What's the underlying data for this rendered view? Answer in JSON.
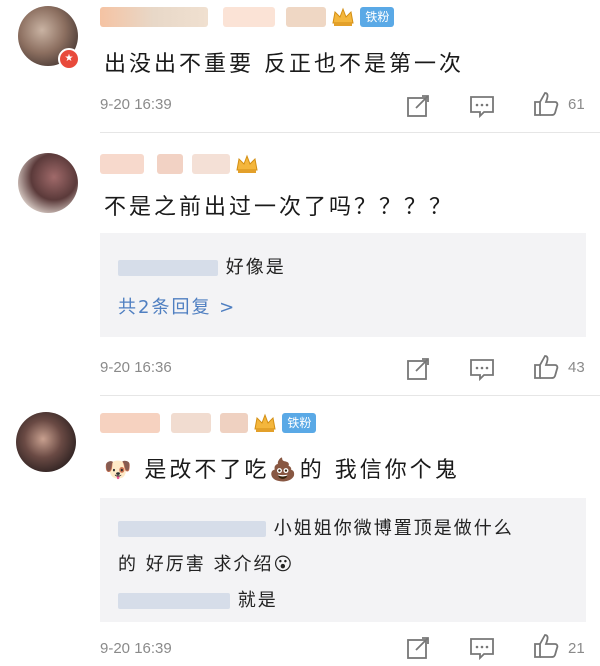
{
  "comments": [
    {
      "content": "出没出不重要 反正也不是第一次",
      "time": "9-20 16:39",
      "likes": "61",
      "fan_badge": "铁粉"
    },
    {
      "content": "不是之前出过一次了吗？？？？",
      "time": "9-20 16:36",
      "likes": "43",
      "reply": {
        "text": "好像是",
        "more": "共2条回复 >"
      }
    },
    {
      "content": "是改不了吃💩的 我信你个鬼",
      "emoji_left": "🐶",
      "time": "9-20 16:39",
      "likes": "21",
      "fan_badge": "铁粉",
      "reply": {
        "line1": "小姐姐你微博置顶是做什么",
        "line2": "的 好厉害 求介绍😮",
        "line3": "就是"
      }
    }
  ],
  "icons": {
    "edit": "share-edit-icon",
    "comment": "comment-icon",
    "like": "thumbs-up-icon"
  },
  "colors": {
    "fan_badge": "#5aa9e6",
    "link": "#4f7fc1",
    "muted": "#8a8a8a"
  }
}
